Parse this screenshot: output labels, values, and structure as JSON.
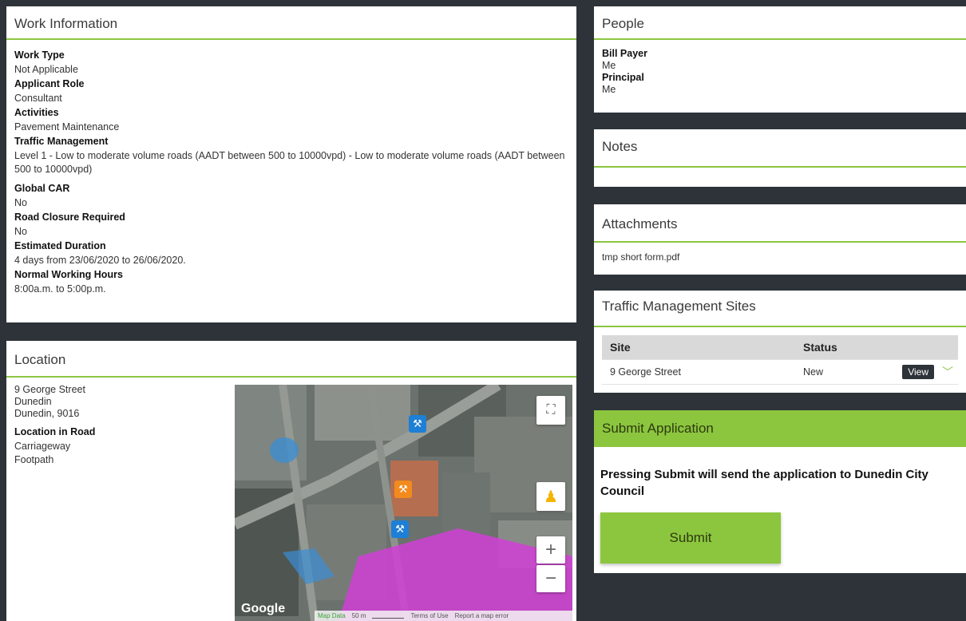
{
  "work_info": {
    "title": "Work Information",
    "fields": [
      {
        "label": "Work Type",
        "value": "Not Applicable"
      },
      {
        "label": "Applicant Role",
        "value": "Consultant"
      },
      {
        "label": "Activities",
        "value": "Pavement Maintenance"
      },
      {
        "label": "Traffic Management",
        "value": "Level 1 - Low to moderate volume roads (AADT between 500 to 10000vpd) - Low to moderate volume roads (AADT between 500 to 10000vpd)"
      },
      {
        "label": "Global CAR",
        "value": "No"
      },
      {
        "label": "Road Closure Required",
        "value": "No"
      },
      {
        "label": "Estimated Duration",
        "value": "4 days from 23/06/2020 to 26/06/2020."
      },
      {
        "label": "Normal Working Hours",
        "value": "8:00a.m. to 5:00p.m."
      }
    ]
  },
  "location": {
    "title": "Location",
    "address_lines": [
      "9 George Street",
      "Dunedin",
      "Dunedin, 9016"
    ],
    "road_label": "Location in Road",
    "road_values": [
      "Carriageway",
      "Footpath"
    ],
    "map": {
      "logo": "Google",
      "footer": [
        "Map Data",
        "50 m",
        "Terms of Use",
        "Report a map error"
      ],
      "zoom_in": "+",
      "zoom_out": "−"
    }
  },
  "people": {
    "title": "People",
    "fields": [
      {
        "label": "Bill Payer",
        "value": "Me"
      },
      {
        "label": "Principal",
        "value": "Me"
      }
    ]
  },
  "notes": {
    "title": "Notes"
  },
  "attachments": {
    "title": "Attachments",
    "files": [
      "tmp short form.pdf"
    ]
  },
  "tms": {
    "title": "Traffic Management Sites",
    "columns": [
      "Site",
      "Status"
    ],
    "rows": [
      {
        "site": "9 George Street",
        "status": "New",
        "action": "View"
      }
    ]
  },
  "submit": {
    "title": "Submit Application",
    "message_pre": "Pressing ",
    "message_bold": "Submit",
    "message_post": " will send the application to Dunedin City Council",
    "button": "Submit"
  },
  "colors": {
    "accent": "#8cc63f",
    "background": "#2d3338"
  }
}
